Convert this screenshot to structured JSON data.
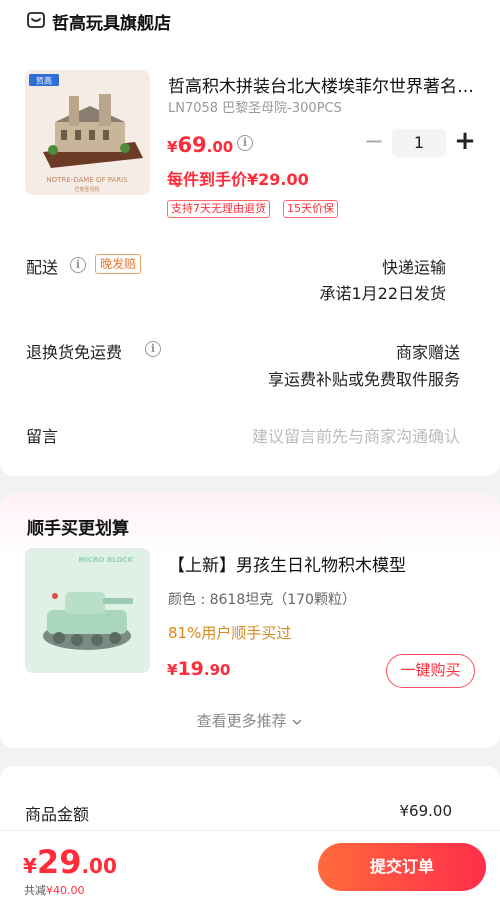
{
  "shop": {
    "name": "哲高玩具旗舰店",
    "icon": "shop-icon"
  },
  "product": {
    "title": "哲高积木拼装台北大楼埃菲尔世界著名建筑",
    "spec": "LN7058 巴黎圣母院-300PCS",
    "price": {
      "symbol": "¥",
      "integer": "69",
      "decimal": ".00"
    },
    "quantity": "1",
    "minus": "−",
    "plus": "+",
    "hand_price": "每件到手价¥29.00",
    "tags": [
      "支持7天无理由退货",
      "15天价保"
    ],
    "image_text": {
      "brand": "哲高",
      "caption": "NOTRE-DAME OF PARIS",
      "subcaption": "巴黎圣母院"
    }
  },
  "delivery": {
    "label": "配送",
    "badge": "晚发赔",
    "method": "快递运输",
    "promise": "承诺1月22日发货"
  },
  "return_shipping": {
    "label": "退换货免运费",
    "value": "商家赠送",
    "detail": "享运费补贴或免费取件服务"
  },
  "message": {
    "label": "留言",
    "placeholder": "建议留言前先与商家沟通确认"
  },
  "recommend": {
    "title": "顺手买更划算",
    "item": {
      "name": "【上新】男孩生日礼物积木模型",
      "spec": "颜色 : 8618坦克（170颗粒）",
      "bought": "81%用户顺手买过",
      "price": {
        "symbol": "¥",
        "integer": "19",
        "decimal": ".90"
      },
      "buy_label": "一键购买",
      "image_text": {
        "brand": "MICRO BLOCK"
      }
    },
    "more": "查看更多推荐",
    "more_icon": "chevron-down-icon"
  },
  "summary": {
    "goods_label": "商品金额",
    "goods_value": "¥69.00"
  },
  "bottom": {
    "total": {
      "symbol": "¥",
      "integer": "29",
      "decimal": ".00"
    },
    "saved_prefix": "共减",
    "saved_amount": "¥40.00",
    "submit_label": "提交订单"
  },
  "colors": {
    "accent": "#ff2d3a",
    "warning": "#e7762a",
    "submit_gradient": [
      "#ff6a3d",
      "#ff2d4a"
    ]
  }
}
